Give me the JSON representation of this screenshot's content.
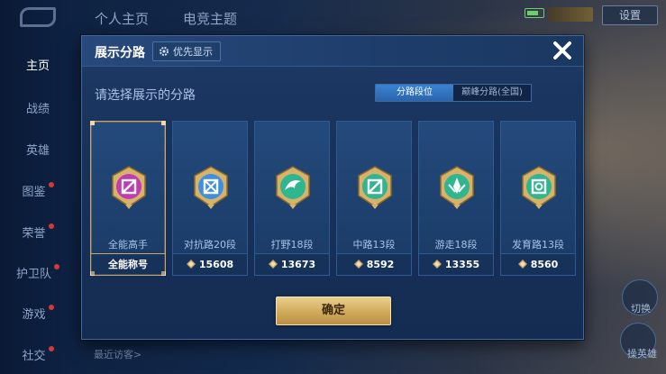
{
  "background": {
    "top_tabs": [
      "个人主页",
      "电竞主题"
    ],
    "top_right_button": "设置",
    "nav_items": [
      {
        "label": "主页",
        "active": true,
        "dot": false
      },
      {
        "label": "战绩",
        "active": false,
        "dot": false
      },
      {
        "label": "英雄",
        "active": false,
        "dot": false
      },
      {
        "label": "图鉴",
        "active": false,
        "dot": true
      },
      {
        "label": "荣誉",
        "active": false,
        "dot": true
      },
      {
        "label": "护卫队",
        "active": false,
        "dot": true
      },
      {
        "label": "游戏",
        "active": false,
        "dot": true
      },
      {
        "label": "社交",
        "active": false,
        "dot": true
      }
    ],
    "bottom_text": "最近访客>",
    "right_labels": [
      "切换",
      "操英雄"
    ]
  },
  "modal": {
    "title": "展示分路",
    "priority_button": "优先显示",
    "subtitle": "请选择展示的分路",
    "toggle": [
      {
        "label": "分路段位",
        "active": true
      },
      {
        "label": "巅峰分路(全国)",
        "active": false
      }
    ],
    "confirm_label": "确定"
  },
  "cards": [
    {
      "name": "全能高手",
      "value": "全能称号",
      "selected": true,
      "emblem": "all-round-emblem-icon",
      "color": "#c13bb3"
    },
    {
      "name": "对抗路20段",
      "value": "15608",
      "selected": false,
      "emblem": "clash-lane-emblem-icon",
      "color": "#3e8fe0"
    },
    {
      "name": "打野18段",
      "value": "13673",
      "selected": false,
      "emblem": "jungle-emblem-icon",
      "color": "#2fb58f"
    },
    {
      "name": "中路13段",
      "value": "8592",
      "selected": false,
      "emblem": "mid-lane-emblem-icon",
      "color": "#2fb58f"
    },
    {
      "name": "游走18段",
      "value": "13355",
      "selected": false,
      "emblem": "roam-emblem-icon",
      "color": "#2fb58f"
    },
    {
      "name": "发育路13段",
      "value": "8560",
      "selected": false,
      "emblem": "farm-lane-emblem-icon",
      "color": "#2fb58f"
    }
  ],
  "colors": {
    "gold": "#d3ad5e",
    "selected_border": "#c9a66b",
    "toggle_active": "#2a64ad"
  }
}
